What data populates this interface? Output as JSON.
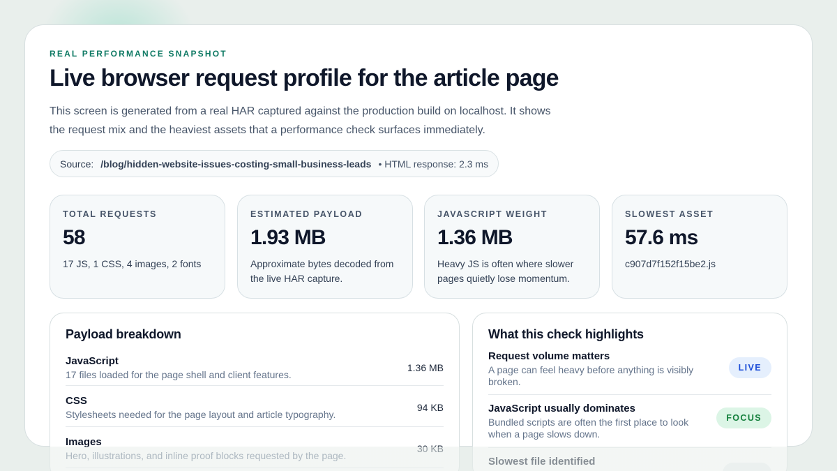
{
  "header": {
    "eyebrow": "REAL PERFORMANCE SNAPSHOT",
    "title": "Live browser request profile for the article page",
    "description": "This screen is generated from a real HAR captured against the production build on localhost. It shows the request mix and the heaviest assets that a performance check surfaces immediately."
  },
  "source": {
    "label": "Source:",
    "path": "/blog/hidden-website-issues-costing-small-business-leads",
    "meta": "• HTML response: 2.3 ms"
  },
  "stats": [
    {
      "label": "TOTAL REQUESTS",
      "value": "58",
      "note": "17 JS, 1 CSS, 4 images, 2 fonts"
    },
    {
      "label": "ESTIMATED PAYLOAD",
      "value": "1.93 MB",
      "note": "Approximate bytes decoded from the live HAR capture."
    },
    {
      "label": "JAVASCRIPT WEIGHT",
      "value": "1.36 MB",
      "note": "Heavy JS is often where slower pages quietly lose momentum."
    },
    {
      "label": "SLOWEST ASSET",
      "value": "57.6 ms",
      "note": "c907d7f152f15be2.js"
    }
  ],
  "breakdown": {
    "title": "Payload breakdown",
    "items": [
      {
        "name": "JavaScript",
        "desc": "17 files loaded for the page shell and client features.",
        "size": "1.36 MB"
      },
      {
        "name": "CSS",
        "desc": "Stylesheets needed for the page layout and article typography.",
        "size": "94 KB"
      },
      {
        "name": "Images",
        "desc": "Hero, illustrations, and inline proof blocks requested by the page.",
        "size": "30 KB"
      }
    ]
  },
  "highlights": {
    "title": "What this check highlights",
    "items": [
      {
        "name": "Request volume matters",
        "desc": "A page can feel heavy before anything is visibly broken.",
        "badge": "LIVE"
      },
      {
        "name": "JavaScript usually dominates",
        "desc": "Bundled scripts are often the first place to look when a page slows down.",
        "badge": "FOCUS"
      },
      {
        "name": "Slowest file identified",
        "desc": "",
        "badge": ""
      }
    ]
  },
  "colors": {
    "accent": "#0f7a64",
    "live_badge": "#1d4ed8",
    "focus_badge": "#15803d"
  }
}
